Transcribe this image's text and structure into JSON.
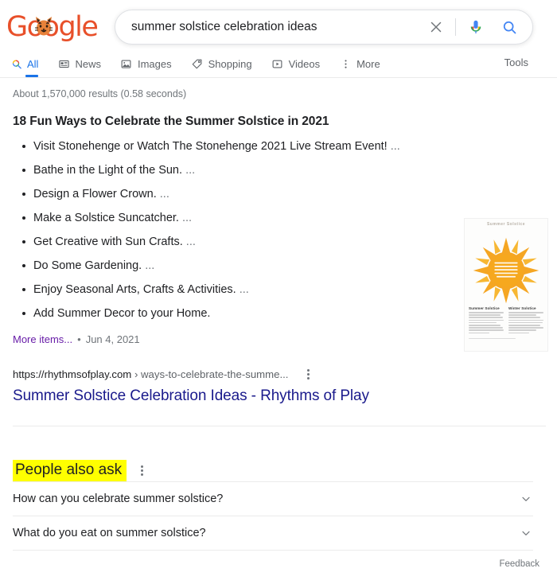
{
  "header": {
    "logo_text": "Google",
    "logo_color": "#e8502a",
    "logo_doodle_name": "tiger-doodle"
  },
  "search": {
    "query": "summer solstice celebration ideas",
    "placeholder": "Search Google or type a URL",
    "clear_icon": "close-icon",
    "mic_icon": "microphone-icon",
    "search_icon": "search-icon"
  },
  "nav": {
    "tabs": [
      {
        "label": "All",
        "icon": "search-icon",
        "active": true
      },
      {
        "label": "News",
        "icon": "news-icon",
        "active": false
      },
      {
        "label": "Images",
        "icon": "image-icon",
        "active": false
      },
      {
        "label": "Shopping",
        "icon": "tag-icon",
        "active": false
      },
      {
        "label": "Videos",
        "icon": "video-icon",
        "active": false
      },
      {
        "label": "More",
        "icon": "kebab-icon",
        "active": false
      }
    ],
    "tools_label": "Tools"
  },
  "results": {
    "stats": "About 1,570,000 results (0.58 seconds)",
    "featured": {
      "title": "18 Fun Ways to Celebrate the Summer Solstice in 2021",
      "items": [
        {
          "text": "Visit Stonehenge or Watch The Stonehenge 2021 Live Stream Event!",
          "ellipsis": "..."
        },
        {
          "text": "Bathe in the Light of the Sun.",
          "ellipsis": "..."
        },
        {
          "text": "Design a Flower Crown.",
          "ellipsis": "..."
        },
        {
          "text": "Make a Solstice Suncatcher.",
          "ellipsis": "..."
        },
        {
          "text": "Get Creative with Sun Crafts.",
          "ellipsis": "..."
        },
        {
          "text": "Do Some Gardening.",
          "ellipsis": "..."
        },
        {
          "text": "Enjoy Seasonal Arts, Crafts & Activities.",
          "ellipsis": "..."
        },
        {
          "text": "Add Summer Decor to your Home.",
          "ellipsis": ""
        }
      ],
      "more_items_label": "More items...",
      "separator": "•",
      "date": "Jun 4, 2021",
      "thumbnail": {
        "alt_name": "solstice-infographic-thumbnail",
        "heading": "Summer Solstice",
        "col_left_title": "Summer Solstice",
        "col_right_title": "Winter Solstice"
      },
      "source_url_domain": "https://rhythmsofplay.com",
      "source_url_arrow": "›",
      "source_url_path": "ways-to-celebrate-the-summe...",
      "link_title": "Summer Solstice Celebration Ideas - Rhythms of Play"
    }
  },
  "people_also_ask": {
    "title": "People also ask",
    "highlight_color": "#ffff00",
    "questions": [
      {
        "text": "How can you celebrate summer solstice?",
        "expand_icon": "chevron-down-icon"
      },
      {
        "text": "What do you eat on summer solstice?",
        "expand_icon": "chevron-down-icon"
      }
    ],
    "feedback_label": "Feedback"
  }
}
